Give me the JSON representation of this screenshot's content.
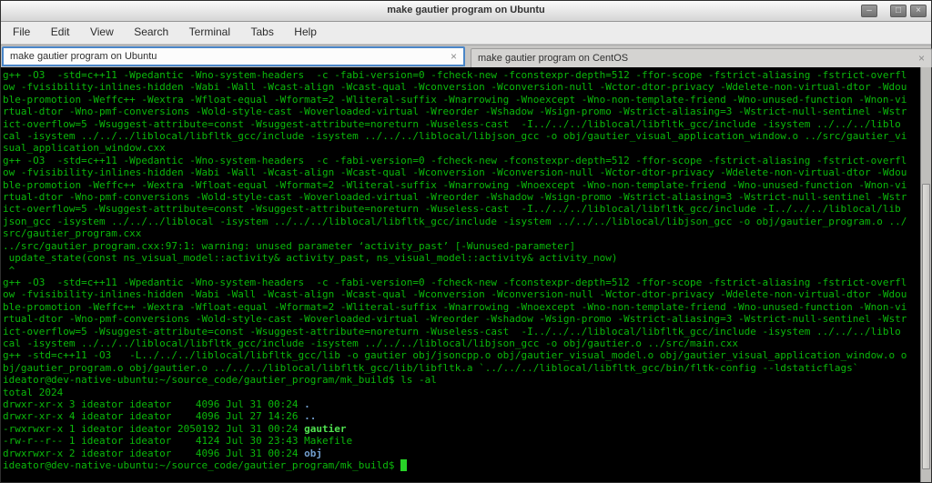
{
  "window": {
    "title": "make gautier program on Ubuntu",
    "controls": {
      "minimize_glyph": "–",
      "maximize_glyph": "□",
      "close_glyph": "×"
    }
  },
  "menu": {
    "items": [
      "File",
      "Edit",
      "View",
      "Search",
      "Terminal",
      "Tabs",
      "Help"
    ]
  },
  "tabs": [
    {
      "label": "make gautier program on Ubuntu",
      "active": true,
      "close_glyph": "×"
    },
    {
      "label": "make gautier program on CentOS",
      "active": false,
      "close_glyph": "×"
    }
  ],
  "terminal": {
    "colors": {
      "background": "#000000",
      "text_green": "#0bb80b",
      "executable_green": "#50e350",
      "directory_blue": "#729fcf",
      "cursor_green": "#27d427",
      "active_tab_border": "#4a86c8"
    },
    "prompt": "ideator@dev-native-ubuntu:~/source_code/gautier_program/mk_build$",
    "lines": [
      "g++ -O3  -std=c++11 -Wpedantic -Wno-system-headers  -c -fabi-version=0 -fcheck-new -fconstexpr-depth=512 -ffor-scope -fstrict-aliasing -fstrict-overfl",
      "ow -fvisibility-inlines-hidden -Wabi -Wall -Wcast-align -Wcast-qual -Wconversion -Wconversion-null -Wctor-dtor-privacy -Wdelete-non-virtual-dtor -Wdou",
      "ble-promotion -Weffc++ -Wextra -Wfloat-equal -Wformat=2 -Wliteral-suffix -Wnarrowing -Wnoexcept -Wno-non-template-friend -Wno-unused-function -Wnon-vi",
      "rtual-dtor -Wno-pmf-conversions -Wold-style-cast -Woverloaded-virtual -Wreorder -Wshadow -Wsign-promo -Wstrict-aliasing=3 -Wstrict-null-sentinel -Wstr",
      "ict-overflow=5 -Wsuggest-attribute=const -Wsuggest-attribute=noreturn -Wuseless-cast  -I../../../liblocal/libfltk_gcc/include -isystem ../../../liblo",
      "cal -isystem ../../../liblocal/libfltk_gcc/include -isystem ../../../liblocal/libjson_gcc -o obj/gautier_visual_application_window.o ../src/gautier_vi",
      "sual_application_window.cxx",
      "g++ -O3  -std=c++11 -Wpedantic -Wno-system-headers  -c -fabi-version=0 -fcheck-new -fconstexpr-depth=512 -ffor-scope -fstrict-aliasing -fstrict-overfl",
      "ow -fvisibility-inlines-hidden -Wabi -Wall -Wcast-align -Wcast-qual -Wconversion -Wconversion-null -Wctor-dtor-privacy -Wdelete-non-virtual-dtor -Wdou",
      "ble-promotion -Weffc++ -Wextra -Wfloat-equal -Wformat=2 -Wliteral-suffix -Wnarrowing -Wnoexcept -Wno-non-template-friend -Wno-unused-function -Wnon-vi",
      "rtual-dtor -Wno-pmf-conversions -Wold-style-cast -Woverloaded-virtual -Wreorder -Wshadow -Wsign-promo -Wstrict-aliasing=3 -Wstrict-null-sentinel -Wstr",
      "ict-overflow=5 -Wsuggest-attribute=const -Wsuggest-attribute=noreturn -Wuseless-cast  -I../../../liblocal/libfltk_gcc/include -I../../../liblocal/lib",
      "json_gcc -isystem ../../../liblocal -isystem ../../../liblocal/libfltk_gcc/include -isystem ../../../liblocal/libjson_gcc -o obj/gautier_program.o ../",
      "src/gautier_program.cxx",
      "../src/gautier_program.cxx:97:1: warning: unused parameter ‘activity_past’ [-Wunused-parameter]",
      " update_state(const ns_visual_model::activity& activity_past, ns_visual_model::activity& activity_now)",
      " ^",
      "g++ -O3  -std=c++11 -Wpedantic -Wno-system-headers  -c -fabi-version=0 -fcheck-new -fconstexpr-depth=512 -ffor-scope -fstrict-aliasing -fstrict-overfl",
      "ow -fvisibility-inlines-hidden -Wabi -Wall -Wcast-align -Wcast-qual -Wconversion -Wconversion-null -Wctor-dtor-privacy -Wdelete-non-virtual-dtor -Wdou",
      "ble-promotion -Weffc++ -Wextra -Wfloat-equal -Wformat=2 -Wliteral-suffix -Wnarrowing -Wnoexcept -Wno-non-template-friend -Wno-unused-function -Wnon-vi",
      "rtual-dtor -Wno-pmf-conversions -Wold-style-cast -Woverloaded-virtual -Wreorder -Wshadow -Wsign-promo -Wstrict-aliasing=3 -Wstrict-null-sentinel -Wstr",
      "ict-overflow=5 -Wsuggest-attribute=const -Wsuggest-attribute=noreturn -Wuseless-cast  -I../../../liblocal/libfltk_gcc/include -isystem ../../../liblo",
      "cal -isystem ../../../liblocal/libfltk_gcc/include -isystem ../../../liblocal/libjson_gcc -o obj/gautier.o ../src/main.cxx",
      "g++ -std=c++11 -O3   -L../../../liblocal/libfltk_gcc/lib -o gautier obj/jsoncpp.o obj/gautier_visual_model.o obj/gautier_visual_application_window.o o",
      "bj/gautier_program.o obj/gautier.o ../../../liblocal/libfltk_gcc/lib/libfltk.a `../../../liblocal/libfltk_gcc/bin/fltk-config --ldstaticflags`",
      "ideator@dev-native-ubuntu:~/source_code/gautier_program/mk_build$ ls -al",
      "total 2024",
      [
        {
          "t": "drwxr-xr-x 3 ideator ideator    4096 Jul 31 00:24 "
        },
        {
          "t": ".",
          "c": "dir"
        }
      ],
      [
        {
          "t": "drwxr-xr-x 4 ideator ideator    4096 Jul 27 14:26 "
        },
        {
          "t": "..",
          "c": "dir"
        }
      ],
      [
        {
          "t": "-rwxrwxr-x 1 ideator ideator 2050192 Jul 31 00:24 "
        },
        {
          "t": "gautier",
          "c": "exec"
        }
      ],
      "-rw-r--r-- 1 ideator ideator    4124 Jul 30 23:43 Makefile",
      [
        {
          "t": "drwxrwxr-x 2 ideator ideator    4096 Jul 31 00:24 "
        },
        {
          "t": "obj",
          "c": "dir"
        }
      ],
      [
        {
          "t": "ideator@dev-native-ubuntu:~/source_code/gautier_program/mk_build$ "
        },
        {
          "t": " ",
          "c": "cursor"
        }
      ]
    ]
  }
}
